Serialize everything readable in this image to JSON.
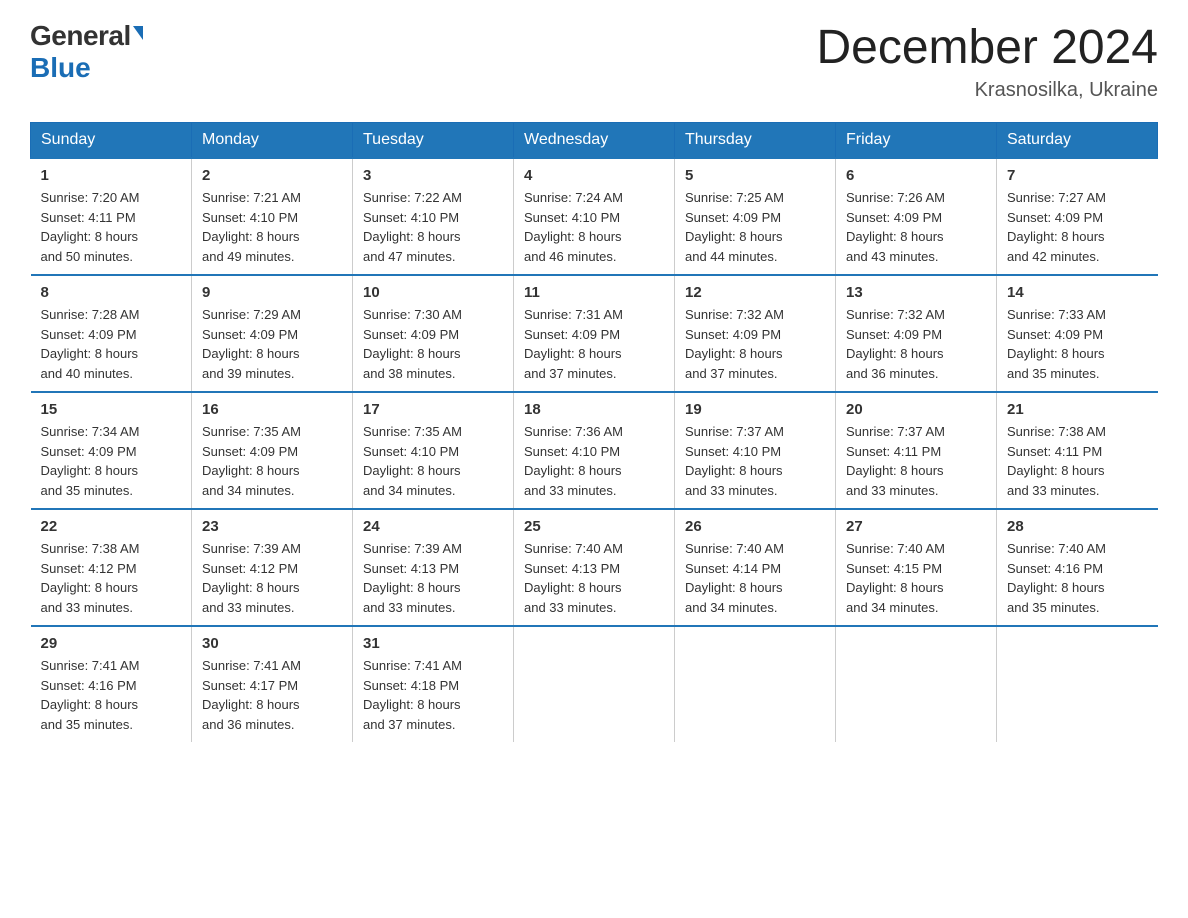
{
  "logo": {
    "general": "General",
    "blue": "Blue"
  },
  "header": {
    "month_year": "December 2024",
    "location": "Krasnosilka, Ukraine"
  },
  "days_of_week": [
    "Sunday",
    "Monday",
    "Tuesday",
    "Wednesday",
    "Thursday",
    "Friday",
    "Saturday"
  ],
  "weeks": [
    [
      {
        "day": "1",
        "info": "Sunrise: 7:20 AM\nSunset: 4:11 PM\nDaylight: 8 hours\nand 50 minutes."
      },
      {
        "day": "2",
        "info": "Sunrise: 7:21 AM\nSunset: 4:10 PM\nDaylight: 8 hours\nand 49 minutes."
      },
      {
        "day": "3",
        "info": "Sunrise: 7:22 AM\nSunset: 4:10 PM\nDaylight: 8 hours\nand 47 minutes."
      },
      {
        "day": "4",
        "info": "Sunrise: 7:24 AM\nSunset: 4:10 PM\nDaylight: 8 hours\nand 46 minutes."
      },
      {
        "day": "5",
        "info": "Sunrise: 7:25 AM\nSunset: 4:09 PM\nDaylight: 8 hours\nand 44 minutes."
      },
      {
        "day": "6",
        "info": "Sunrise: 7:26 AM\nSunset: 4:09 PM\nDaylight: 8 hours\nand 43 minutes."
      },
      {
        "day": "7",
        "info": "Sunrise: 7:27 AM\nSunset: 4:09 PM\nDaylight: 8 hours\nand 42 minutes."
      }
    ],
    [
      {
        "day": "8",
        "info": "Sunrise: 7:28 AM\nSunset: 4:09 PM\nDaylight: 8 hours\nand 40 minutes."
      },
      {
        "day": "9",
        "info": "Sunrise: 7:29 AM\nSunset: 4:09 PM\nDaylight: 8 hours\nand 39 minutes."
      },
      {
        "day": "10",
        "info": "Sunrise: 7:30 AM\nSunset: 4:09 PM\nDaylight: 8 hours\nand 38 minutes."
      },
      {
        "day": "11",
        "info": "Sunrise: 7:31 AM\nSunset: 4:09 PM\nDaylight: 8 hours\nand 37 minutes."
      },
      {
        "day": "12",
        "info": "Sunrise: 7:32 AM\nSunset: 4:09 PM\nDaylight: 8 hours\nand 37 minutes."
      },
      {
        "day": "13",
        "info": "Sunrise: 7:32 AM\nSunset: 4:09 PM\nDaylight: 8 hours\nand 36 minutes."
      },
      {
        "day": "14",
        "info": "Sunrise: 7:33 AM\nSunset: 4:09 PM\nDaylight: 8 hours\nand 35 minutes."
      }
    ],
    [
      {
        "day": "15",
        "info": "Sunrise: 7:34 AM\nSunset: 4:09 PM\nDaylight: 8 hours\nand 35 minutes."
      },
      {
        "day": "16",
        "info": "Sunrise: 7:35 AM\nSunset: 4:09 PM\nDaylight: 8 hours\nand 34 minutes."
      },
      {
        "day": "17",
        "info": "Sunrise: 7:35 AM\nSunset: 4:10 PM\nDaylight: 8 hours\nand 34 minutes."
      },
      {
        "day": "18",
        "info": "Sunrise: 7:36 AM\nSunset: 4:10 PM\nDaylight: 8 hours\nand 33 minutes."
      },
      {
        "day": "19",
        "info": "Sunrise: 7:37 AM\nSunset: 4:10 PM\nDaylight: 8 hours\nand 33 minutes."
      },
      {
        "day": "20",
        "info": "Sunrise: 7:37 AM\nSunset: 4:11 PM\nDaylight: 8 hours\nand 33 minutes."
      },
      {
        "day": "21",
        "info": "Sunrise: 7:38 AM\nSunset: 4:11 PM\nDaylight: 8 hours\nand 33 minutes."
      }
    ],
    [
      {
        "day": "22",
        "info": "Sunrise: 7:38 AM\nSunset: 4:12 PM\nDaylight: 8 hours\nand 33 minutes."
      },
      {
        "day": "23",
        "info": "Sunrise: 7:39 AM\nSunset: 4:12 PM\nDaylight: 8 hours\nand 33 minutes."
      },
      {
        "day": "24",
        "info": "Sunrise: 7:39 AM\nSunset: 4:13 PM\nDaylight: 8 hours\nand 33 minutes."
      },
      {
        "day": "25",
        "info": "Sunrise: 7:40 AM\nSunset: 4:13 PM\nDaylight: 8 hours\nand 33 minutes."
      },
      {
        "day": "26",
        "info": "Sunrise: 7:40 AM\nSunset: 4:14 PM\nDaylight: 8 hours\nand 34 minutes."
      },
      {
        "day": "27",
        "info": "Sunrise: 7:40 AM\nSunset: 4:15 PM\nDaylight: 8 hours\nand 34 minutes."
      },
      {
        "day": "28",
        "info": "Sunrise: 7:40 AM\nSunset: 4:16 PM\nDaylight: 8 hours\nand 35 minutes."
      }
    ],
    [
      {
        "day": "29",
        "info": "Sunrise: 7:41 AM\nSunset: 4:16 PM\nDaylight: 8 hours\nand 35 minutes."
      },
      {
        "day": "30",
        "info": "Sunrise: 7:41 AM\nSunset: 4:17 PM\nDaylight: 8 hours\nand 36 minutes."
      },
      {
        "day": "31",
        "info": "Sunrise: 7:41 AM\nSunset: 4:18 PM\nDaylight: 8 hours\nand 37 minutes."
      },
      {
        "day": "",
        "info": ""
      },
      {
        "day": "",
        "info": ""
      },
      {
        "day": "",
        "info": ""
      },
      {
        "day": "",
        "info": ""
      }
    ]
  ]
}
